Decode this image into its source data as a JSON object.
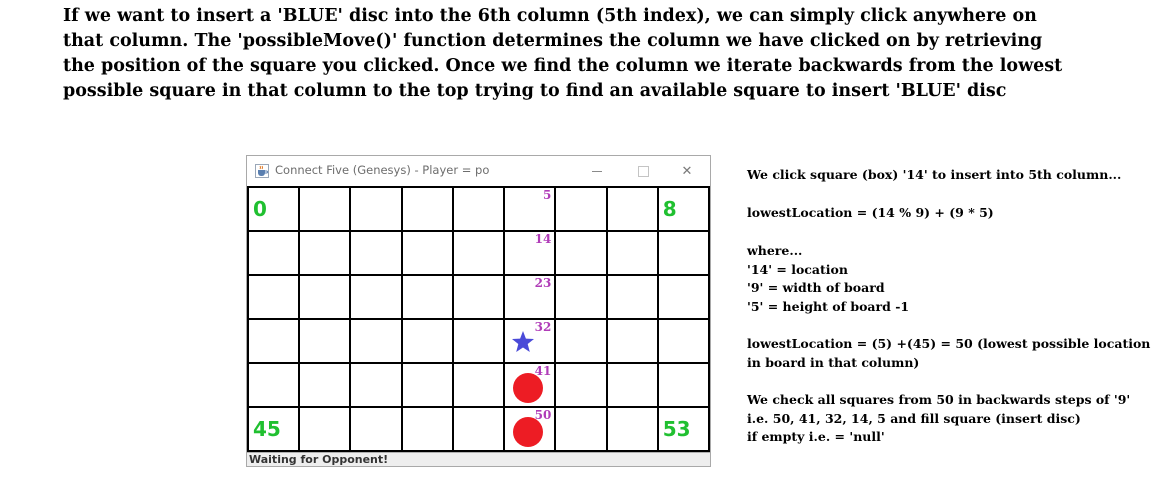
{
  "intro_lines": [
    "If we want to insert a 'BLUE' disc into the 6th column (5th index), we can simply click anywhere on",
    "that column. The 'possibleMove()' function determines the column we have clicked on by retrieving",
    "the position of the square you clicked. Once we find the column we iterate backwards from the lowest",
    "possible square in that column to the top trying to find an available square to insert 'BLUE' disc"
  ],
  "window": {
    "title": "Connect Five (Genesys) - Player = po",
    "app_icon": "java-cup-icon",
    "controls": {
      "minimize": "minimize-icon",
      "maximize": "maximize-icon",
      "close": "close-icon"
    },
    "close_glyph": "✕"
  },
  "board": {
    "columns": 9,
    "rows": 6,
    "corner_labels": {
      "top_left": "0",
      "top_right": "8",
      "bottom_left": "45",
      "bottom_right": "53"
    },
    "index_labels": [
      "5",
      "14",
      "23",
      "32",
      "41",
      "50"
    ],
    "corner_color": "#20c030",
    "index_color": "#b03cb8",
    "pieces": [
      {
        "row": 3,
        "col": 5,
        "type": "star",
        "color": "#4a4ad8"
      },
      {
        "row": 4,
        "col": 5,
        "type": "disc",
        "color": "#ed1c24"
      },
      {
        "row": 5,
        "col": 5,
        "type": "disc",
        "color": "#ed1c24"
      }
    ]
  },
  "status": "Waiting for Opponent!",
  "notes": {
    "line1": "We click square (box) '14' to insert into 5th column...",
    "line2": "lowestLocation = (14 % 9) + (9 * 5)",
    "line3": "where...",
    "line4": "'14' = location",
    "line5": "'9' = width of board",
    "line6": "'5' = height of board -1",
    "line7": "lowestLocation = (5) +(45) = 50 (lowest possible location",
    "line8": "in board in that column)",
    "line9": "We check all squares from 50 in backwards steps of '9'",
    "line10": "i.e. 50, 41, 32, 14, 5 and fill square (insert disc)",
    "line11": "if empty i.e. = 'null'"
  }
}
